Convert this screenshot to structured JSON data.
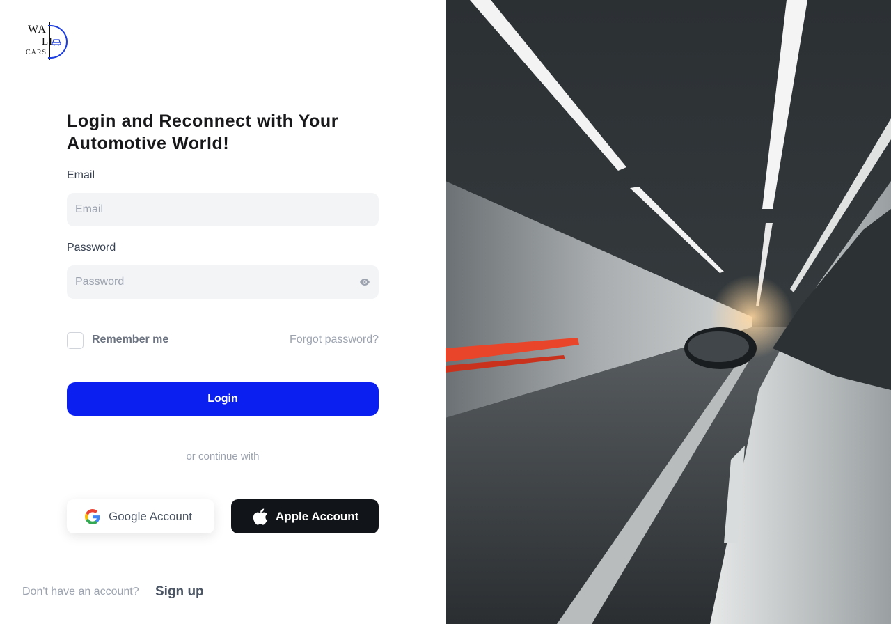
{
  "logo": {
    "line1": "WA",
    "line2": "LI",
    "line3": "CARS"
  },
  "title": "Login and Reconnect with Your Automotive World!",
  "form": {
    "email_label": "Email",
    "email_placeholder": "Email",
    "password_label": "Password",
    "password_placeholder": "Password",
    "remember_label": "Remember me",
    "forgot_label": "Forgot password?",
    "login_label": "Login"
  },
  "divider_text": "or continue with",
  "social": {
    "google_label": "Google Account",
    "apple_label": "Apple Account"
  },
  "footer": {
    "question": "Don't have an account?",
    "signup_label": "Sign up"
  },
  "colors": {
    "primary": "#0a1ff0",
    "apple_button": "#111418",
    "input_bg": "#f3f4f6"
  },
  "icons": [
    "eye-icon",
    "google-icon",
    "apple-icon",
    "car-icon"
  ]
}
